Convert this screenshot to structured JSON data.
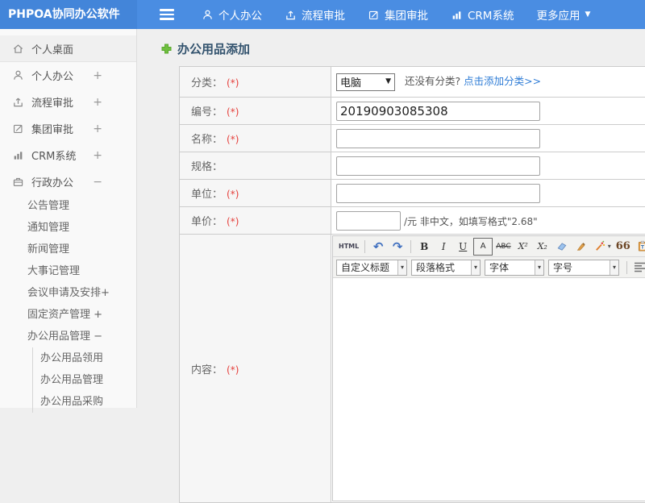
{
  "colors": {
    "topbar_blue": "#4a8de2",
    "brand_blue": "#4385d9",
    "link_blue": "#2e7cd6",
    "required_red": "#e5403c",
    "title_navy": "#33536e",
    "plus_green": "#6fbf3f"
  },
  "topbar": {
    "brand": "PHPOA协同办公软件",
    "nav": [
      {
        "label": "个人办公",
        "icon": "user-icon"
      },
      {
        "label": "流程审批",
        "icon": "process-icon"
      },
      {
        "label": "集团审批",
        "icon": "edit-icon"
      },
      {
        "label": "CRM系统",
        "icon": "chart-icon"
      },
      {
        "label": "更多应用",
        "icon": "caret-down-icon"
      }
    ]
  },
  "sidebar": {
    "items": [
      {
        "label": "个人桌面",
        "icon": "home-icon",
        "expander": ""
      },
      {
        "label": "个人办公",
        "icon": "user-icon",
        "expander": "+"
      },
      {
        "label": "流程审批",
        "icon": "process-icon",
        "expander": "+"
      },
      {
        "label": "集团审批",
        "icon": "edit-icon",
        "expander": "+"
      },
      {
        "label": "CRM系统",
        "icon": "chart-icon",
        "expander": "+"
      },
      {
        "label": "行政办公",
        "icon": "briefcase-icon",
        "expander": "−"
      }
    ],
    "admin_children": [
      "公告管理",
      "通知管理",
      "新闻管理",
      "大事记管理",
      "会议申请及安排+",
      "固定资产管理 +",
      "办公用品管理 −"
    ],
    "supplies_children": [
      "办公用品领用",
      "办公用品管理",
      "办公用品采购"
    ]
  },
  "page": {
    "title": "办公用品添加"
  },
  "form": {
    "category": {
      "label": "分类：",
      "required": "(*)",
      "value": "电脑",
      "hint": "还没有分类?",
      "link": "点击添加分类>>"
    },
    "code": {
      "label": "编号：",
      "required": "(*)",
      "value": "20190903085308"
    },
    "name": {
      "label": "名称：",
      "required": "(*)",
      "value": ""
    },
    "spec": {
      "label": "规格：",
      "required": "",
      "value": ""
    },
    "unit": {
      "label": "单位：",
      "required": "(*)",
      "value": ""
    },
    "price": {
      "label": "单价：",
      "required": "(*)",
      "value": "",
      "suffix": "/元 非中文，如填写格式\"2.68\""
    },
    "content": {
      "label": "内容：",
      "required": "(*)"
    }
  },
  "editor": {
    "buttons": {
      "html": "HTML",
      "bold": "B",
      "italic": "I",
      "underline": "U",
      "forecolor": "A",
      "strikethrough": "ABC",
      "superscript": "X²",
      "subscript": "X₂",
      "quote": "66",
      "paste_letter": "T",
      "fontcolor": "A",
      "highlight": "ab"
    },
    "selects": [
      {
        "label": "自定义标题"
      },
      {
        "label": "段落格式"
      },
      {
        "label": "字体"
      },
      {
        "label": "字号"
      }
    ]
  },
  "glyphs": {
    "caret_down": "▼",
    "caret_small": "▾",
    "undo": "↶",
    "redo": "↷"
  }
}
